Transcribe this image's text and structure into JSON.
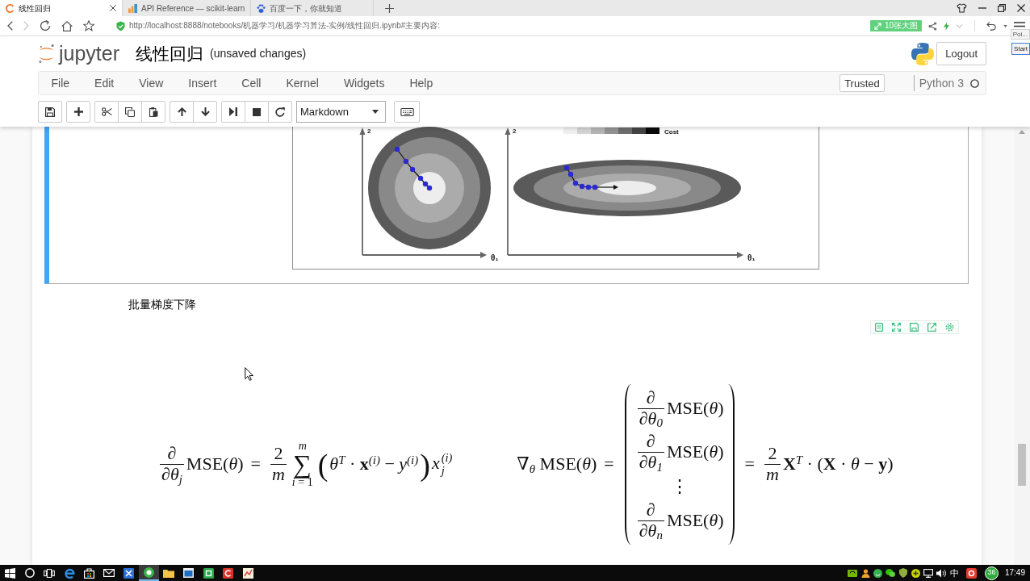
{
  "browser": {
    "tabs": [
      {
        "title": "线性回归",
        "selected": true
      },
      {
        "title": "API Reference — scikit-learn",
        "selected": false
      },
      {
        "title": "百度一下，你就知道",
        "selected": false
      }
    ],
    "forward_disabled": true,
    "url": "http://localhost:8888/notebooks/机器学习/机器学习算法-实例/线性回归.ipynb#主要内容:",
    "extension_button": "10张大图"
  },
  "overlay": {
    "tooltip": "Poi...",
    "button": "Start"
  },
  "notebook": {
    "logo": "jupyter",
    "name": "线性回归",
    "save_status": "(unsaved changes)",
    "logout": "Logout",
    "menu": [
      "File",
      "Edit",
      "View",
      "Insert",
      "Cell",
      "Kernel",
      "Widgets",
      "Help"
    ],
    "trusted": "Trusted",
    "kernel": "Python 3",
    "kernel_busy": false,
    "cell_type": "Markdown"
  },
  "cells": [
    {
      "kind": "figure",
      "selected": true,
      "figure": {
        "plots": [
          {
            "kind": "circle",
            "x_label": "θ₁",
            "y_label": "2"
          },
          {
            "kind": "ellipse",
            "x_label": "θ₁",
            "y_label": "2"
          }
        ],
        "colorbar_label": "Cost"
      }
    },
    {
      "kind": "markdown",
      "selected": false,
      "heading": "批量梯度下降",
      "equations": [
        {
          "terms": [
            {
              "kind": "frac",
              "num": "∂",
              "den": "∂*θ*$_{j}$"
            },
            {
              "kind": "text",
              "text": "MSE(*θ*)"
            },
            {
              "kind": "rel",
              "text": "="
            },
            {
              "kind": "frac",
              "num": "2",
              "den": "*m*"
            },
            {
              "kind": "sum",
              "upper": "*m*",
              "symbol": "∑",
              "lower": "*i* = 1"
            },
            {
              "kind": "delim",
              "text": "("
            },
            {
              "kind": "text",
              "text": "*θ*$^{T}$ · **x**$^{(i)}$ − *y*$^{(i)}$"
            },
            {
              "kind": "delim",
              "text": ")"
            },
            {
              "kind": "subsup",
              "base": "*x*",
              "sup": "(i)",
              "sub": "j"
            }
          ]
        },
        {
          "terms": [
            {
              "kind": "text",
              "text": "∇$_{θ}$ MSE(*θ*)"
            },
            {
              "kind": "rel",
              "text": "="
            },
            {
              "kind": "matrix",
              "entries": [
                {
                  "terms": [
                    {
                      "kind": "frac",
                      "num": "∂",
                      "den": "∂*θ*$_{0}$"
                    },
                    {
                      "kind": "text",
                      "text": "MSE(*θ*)"
                    }
                  ]
                },
                {
                  "terms": [
                    {
                      "kind": "frac",
                      "num": "∂",
                      "den": "∂*θ*$_{1}$"
                    },
                    {
                      "kind": "text",
                      "text": "MSE(*θ*)"
                    }
                  ]
                },
                {
                  "terms": [
                    {
                      "kind": "text",
                      "text": "⋮"
                    }
                  ]
                },
                {
                  "terms": [
                    {
                      "kind": "frac",
                      "num": "∂",
                      "den": "∂*θ*$_{n}$"
                    },
                    {
                      "kind": "text",
                      "text": "MSE(*θ*)"
                    }
                  ]
                }
              ]
            },
            {
              "kind": "rel",
              "text": "="
            },
            {
              "kind": "frac",
              "num": "2",
              "den": "*m*"
            },
            {
              "kind": "text",
              "text": "**X**$^{T}$ · (**X** · *θ* − **y**)"
            }
          ]
        }
      ]
    }
  ],
  "taskbar": {
    "input_method": "中",
    "tray_badge": "36",
    "time": "17:49"
  }
}
